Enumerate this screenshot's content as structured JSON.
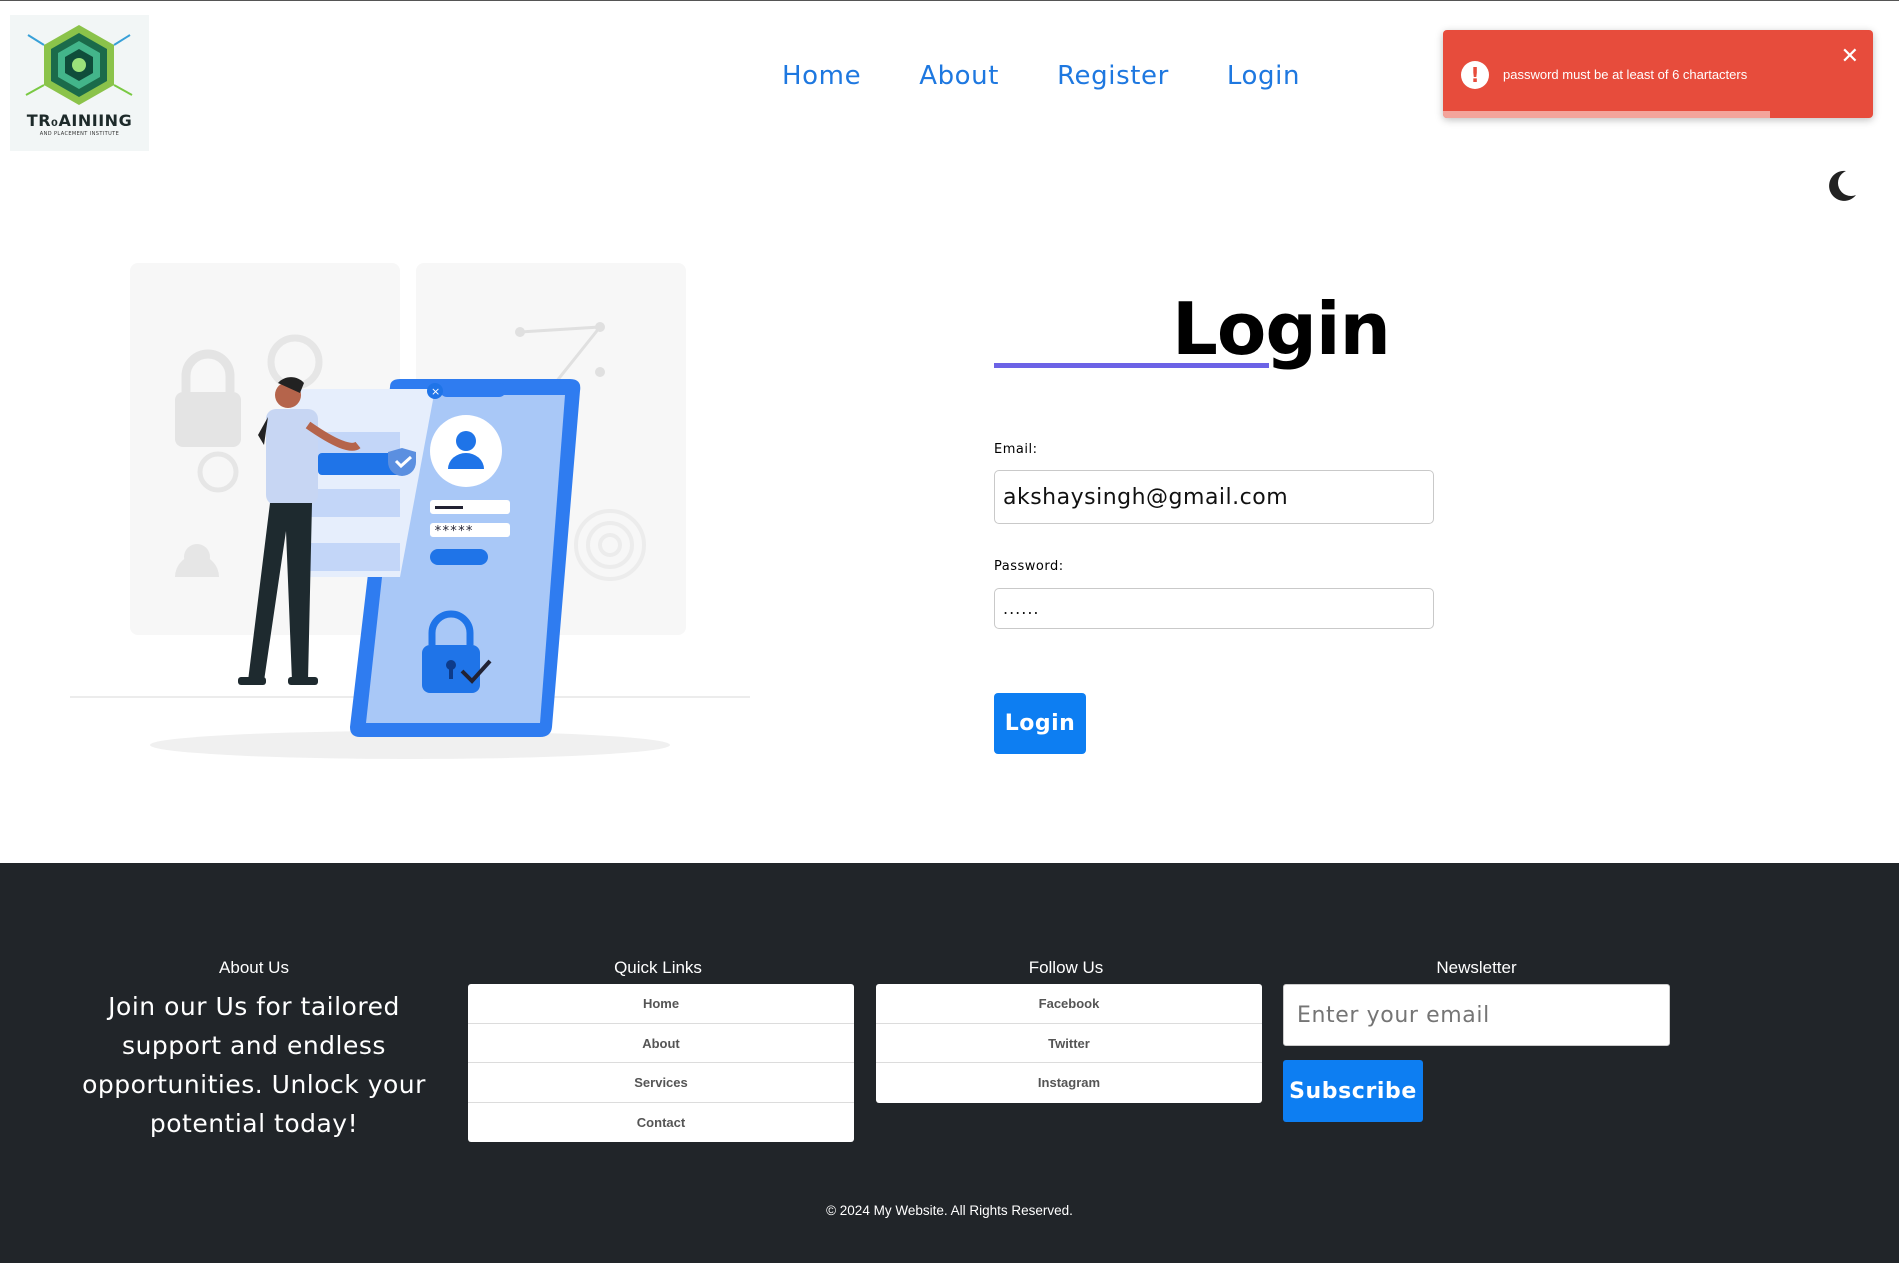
{
  "brand": {
    "logo_text": "TR₀AINIING",
    "logo_subtext": "AND PLACEMENT INSTITUTE",
    "accent_color": "#0d7ef2",
    "error_color": "#e74c3c"
  },
  "nav": {
    "items": [
      {
        "label": "Home"
      },
      {
        "label": "About"
      },
      {
        "label": "Register"
      },
      {
        "label": "Login"
      }
    ]
  },
  "toast": {
    "icon": "exclamation-circle-icon",
    "message": "password must be at least of 6 chartacters",
    "close_icon": "close-icon",
    "remaining_fraction": 0.76
  },
  "theme_toggle": {
    "icon": "moon-icon"
  },
  "login": {
    "title": "Login",
    "email_label": "Email:",
    "email_value": "akshaysingh@gmail.com",
    "password_label": "Password:",
    "password_value": "......",
    "button_label": "Login"
  },
  "footer": {
    "about": {
      "heading": "About Us",
      "text": "Join our Us for tailored support and endless opportunities. Unlock your potential today!"
    },
    "quick_links": {
      "heading": "Quick Links",
      "items": [
        "Home",
        "About",
        "Services",
        "Contact"
      ]
    },
    "follow_us": {
      "heading": "Follow Us",
      "items": [
        "Facebook",
        "Twitter",
        "Instagram"
      ]
    },
    "newsletter": {
      "heading": "Newsletter",
      "placeholder": "Enter your email",
      "button_label": "Subscribe"
    },
    "copyright": "© 2024 My Website. All Rights Reserved."
  }
}
